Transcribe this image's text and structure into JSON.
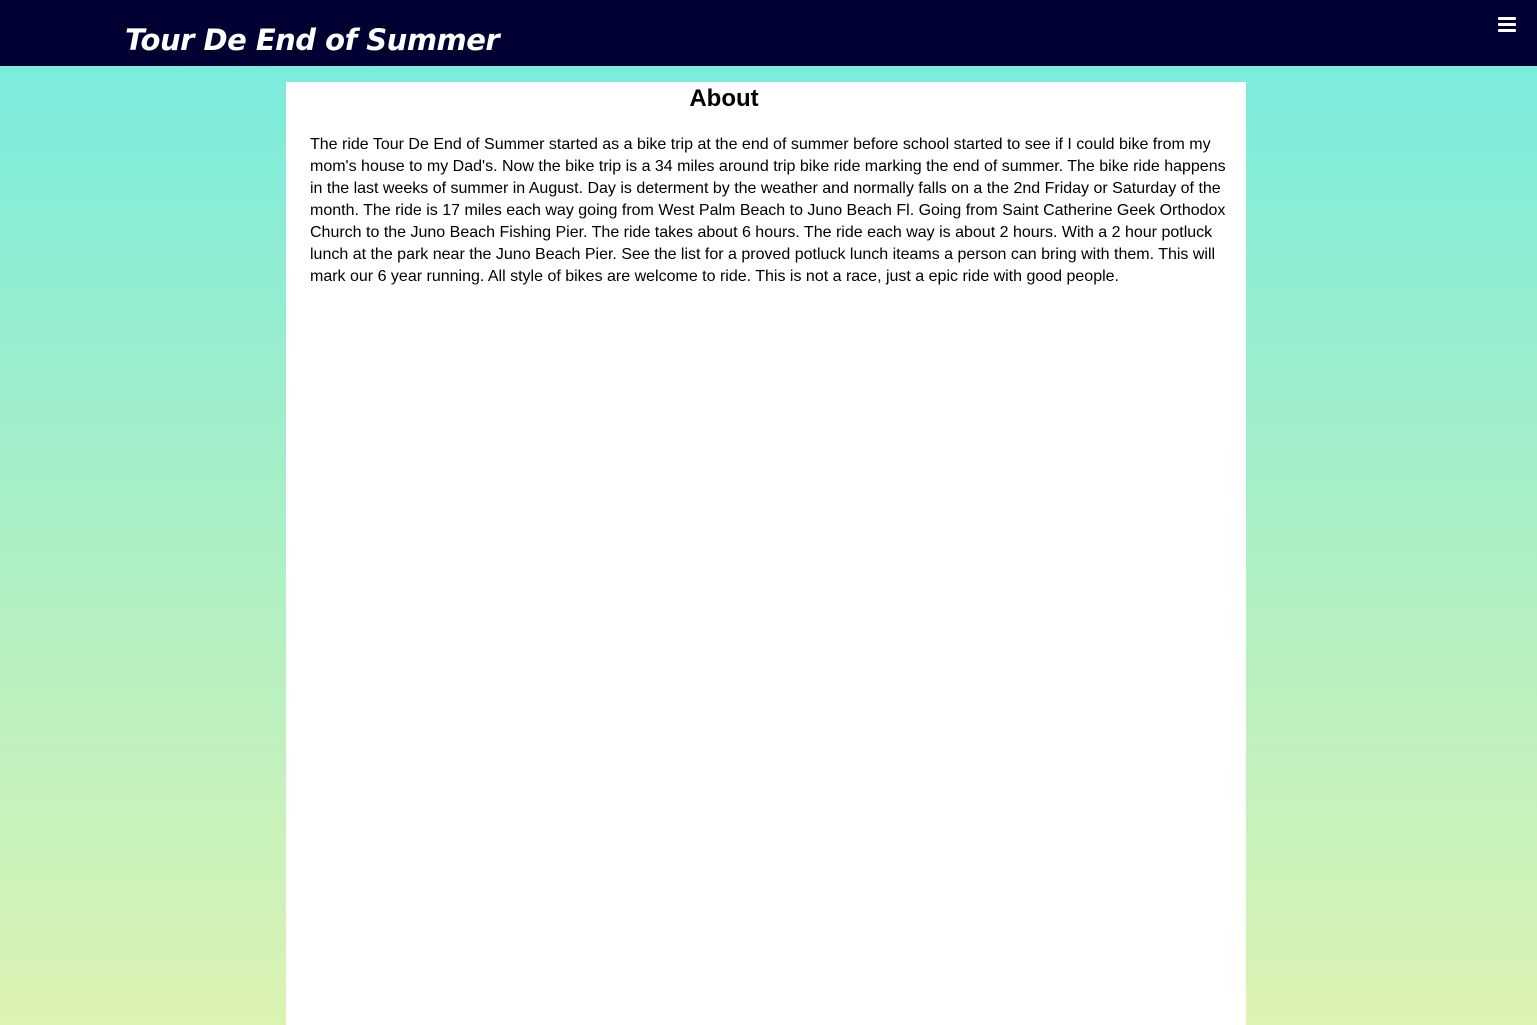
{
  "header": {
    "site_title": "Tour De End of Summer",
    "menu_icon": "hamburger-menu-icon"
  },
  "main": {
    "heading": "About",
    "paragraph": "The ride Tour De End of Summer started as a bike trip at the end of summer before school started to see if I could bike from my mom's house to my Dad's. Now the bike trip is a 34 miles around trip bike ride marking the end of summer. The bike ride happens in the last weeks of summer in August. Day is determent by the weather and normally falls on a the 2nd Friday or Saturday of the month. The ride is 17 miles each way going from West Palm Beach to Juno Beach Fl. Going from Saint Catherine Geek Orthodox Church to the Juno Beach Fishing Pier. The ride takes about 6 hours. The ride each way is about 2 hours. With a 2 hour potluck lunch at the park near the Juno Beach Pier. See the list for a proved potluck lunch iteams a person can bring with them. This will mark our 6 year running. All style of bikes are welcome to ride. This is not a race, just a epic ride with good people."
  },
  "colors": {
    "header_background": "#000033",
    "gradient_top": "#74ebe0",
    "gradient_bottom": "#dcf3b3",
    "card_background": "#ffffff"
  }
}
